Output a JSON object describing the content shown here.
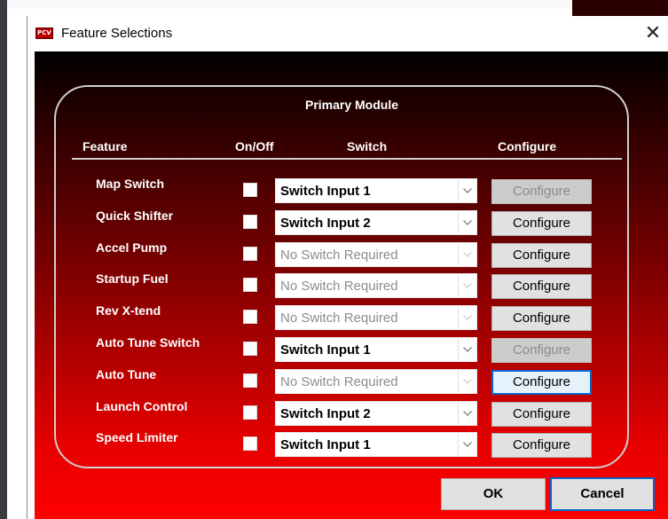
{
  "window": {
    "title": "Feature Selections",
    "app_icon_text": "PCV",
    "close_glyph": "✕"
  },
  "module_title": "Primary Module",
  "columns": {
    "feature": "Feature",
    "onoff": "On/Off",
    "switch": "Switch",
    "configure": "Configure"
  },
  "features": [
    {
      "label": "Map Switch",
      "checked": false,
      "switch": "Switch Input 1",
      "switch_enabled": true,
      "configure": "Configure",
      "configure_enabled": false
    },
    {
      "label": "Quick Shifter",
      "checked": false,
      "switch": "Switch Input 2",
      "switch_enabled": true,
      "configure": "Configure",
      "configure_enabled": true
    },
    {
      "label": "Accel Pump",
      "checked": false,
      "switch": "No Switch Required",
      "switch_enabled": false,
      "configure": "Configure",
      "configure_enabled": true
    },
    {
      "label": "Startup Fuel",
      "checked": false,
      "switch": "No Switch Required",
      "switch_enabled": false,
      "configure": "Configure",
      "configure_enabled": true
    },
    {
      "label": "Rev X-tend",
      "checked": false,
      "switch": "No Switch Required",
      "switch_enabled": false,
      "configure": "Configure",
      "configure_enabled": true
    },
    {
      "label": "Auto Tune Switch",
      "checked": false,
      "switch": "Switch Input 1",
      "switch_enabled": true,
      "configure": "Configure",
      "configure_enabled": false
    },
    {
      "label": "Auto Tune",
      "checked": false,
      "switch": "No Switch Required",
      "switch_enabled": false,
      "configure": "Configure",
      "configure_enabled": true,
      "focused": true
    },
    {
      "label": "Launch Control",
      "checked": false,
      "switch": "Switch Input 2",
      "switch_enabled": true,
      "configure": "Configure",
      "configure_enabled": true
    },
    {
      "label": "Speed Limiter",
      "checked": false,
      "switch": "Switch Input 1",
      "switch_enabled": true,
      "configure": "Configure",
      "configure_enabled": true
    }
  ],
  "footer": {
    "ok_label": "OK",
    "cancel_label": "Cancel"
  },
  "colors": {
    "focus_border": "#0a64c8",
    "gradient_top": "#000000",
    "gradient_bottom": "#ff0000"
  }
}
